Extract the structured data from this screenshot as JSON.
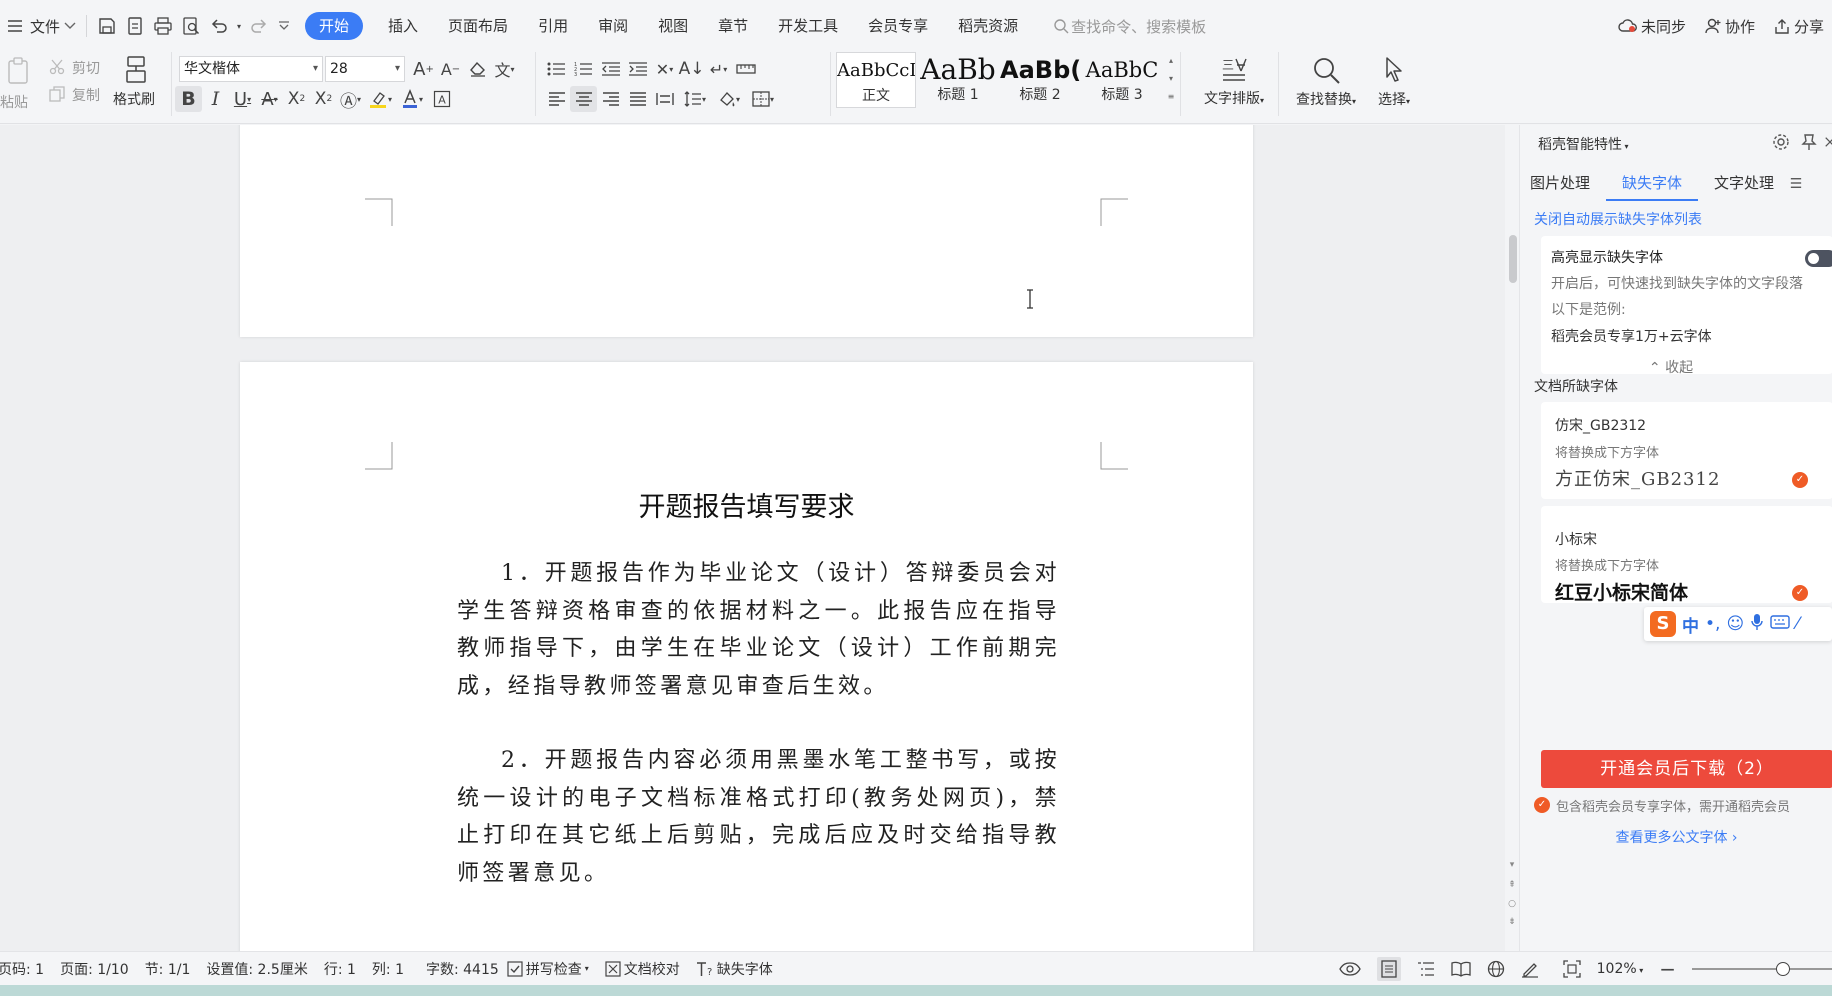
{
  "menubar": {
    "file_label": "文件",
    "tabs": [
      "开始",
      "插入",
      "页面布局",
      "引用",
      "审阅",
      "视图",
      "章节",
      "开发工具",
      "会员专享",
      "稻壳资源"
    ],
    "search_placeholder": "查找命令、搜索模板",
    "sync_label": "未同步",
    "collab_label": "协作",
    "share_label": "分享"
  },
  "ribbon": {
    "paste_label": "粘贴",
    "cut_label": "剪切",
    "copy_label": "复制",
    "format_painter_label": "格式刷",
    "font_name": "华文楷体",
    "font_size": "28",
    "styles": [
      {
        "sample": "AaBbCcI",
        "name": "正文"
      },
      {
        "sample": "AaBb",
        "name": "标题 1"
      },
      {
        "sample": "AaBb(",
        "name": "标题 2"
      },
      {
        "sample": "AaBbC",
        "name": "标题 3"
      }
    ],
    "text_layout_label": "文字排版",
    "find_replace_label": "查找替换",
    "select_label": "选择"
  },
  "document": {
    "title": "开题报告填写要求",
    "paragraphs": [
      "1．开题报告作为毕业论文（设计）答辩委员会对学生答辩资格审查的依据材料之一。此报告应在指导教师指导下，由学生在毕业论文（设计）工作前期完成，经指导教师签署意见审查后生效。",
      "2．开题报告内容必须用黑墨水笔工整书写，或按统一设计的电子文档标准格式打印(教务处网页)，禁止打印在其它纸上后剪贴，完成后应及时交给指导教师签署意见。"
    ]
  },
  "panel": {
    "title": "稻壳智能特性",
    "tabs": [
      "图片处理",
      "缺失字体",
      "文字处理"
    ],
    "close_auto_link": "关闭自动展示缺失字体列表",
    "highlight": {
      "title": "高亮显示缺失字体",
      "desc": "开启后，可快速找到缺失字体的文字段落",
      "example_label": "以下是范例:",
      "example_text": "稻壳会员专享1万+云字体",
      "collapse_label": "收起"
    },
    "missing_title": "文档所缺字体",
    "fonts": [
      {
        "name": "仿宋_GB2312",
        "replace_label": "将替换成下方字体",
        "replacement": "方正仿宋_GB2312"
      },
      {
        "name": "小标宋",
        "replace_label": "将替换成下方字体",
        "replacement": "红豆小标宋简体"
      }
    ],
    "download_button": "开通会员后下载（2）",
    "member_note": "包含稻壳会员专享字体，需开通稻壳会员",
    "more_link": "查看更多公文字体"
  },
  "statusbar": {
    "page_code": "页码: 1",
    "page": "页面: 1/10",
    "section": "节: 1/1",
    "setting": "设置值: 2.5厘米",
    "row": "行: 1",
    "col": "列: 1",
    "word_count": "字数: 4415",
    "spell_check": "拼写检查",
    "doc_proof": "文档校对",
    "missing_font": "缺失字体",
    "zoom": "102%"
  }
}
